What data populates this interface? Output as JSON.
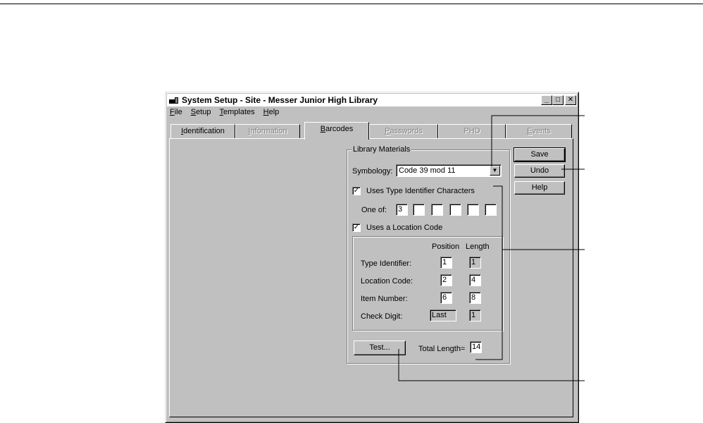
{
  "window": {
    "title": "System Setup - Site - Messer Junior High Library",
    "controls": {
      "minimize": "_",
      "maximize": "□",
      "close": "✕"
    }
  },
  "menu": [
    "File",
    "Setup",
    "Templates",
    "Help"
  ],
  "tabs": [
    {
      "label": "Identification",
      "state": "enabled"
    },
    {
      "label": "Information",
      "state": "disabled"
    },
    {
      "label": "Barcodes",
      "state": "active"
    },
    {
      "label": "Passwords",
      "state": "disabled"
    },
    {
      "label": "PHD",
      "state": "disabled"
    },
    {
      "label": "Events",
      "state": "disabled"
    }
  ],
  "group": {
    "title": "Library Materials",
    "symbology_label": "Symbology:",
    "symbology_value": "Code 39 mod 11",
    "uses_type_identifier": {
      "label": "Uses Type Identifier Characters",
      "checked": true
    },
    "one_of_label": "One of:",
    "one_of_values": [
      "3",
      "",
      "",
      "",
      "",
      ""
    ],
    "uses_location_code": {
      "label": "Uses a Location Code",
      "checked": true
    },
    "table_headers": {
      "position": "Position",
      "length": "Length"
    },
    "rows": [
      {
        "label": "Type Identifier:",
        "position": "1",
        "length": "1"
      },
      {
        "label": "Location Code:",
        "position": "2",
        "length": "4"
      },
      {
        "label": "Item Number:",
        "position": "6",
        "length": "8"
      },
      {
        "label": "Check Digit:",
        "position": "Last",
        "length": "1"
      }
    ],
    "test_button": "Test...",
    "total_length_label": "Total Length=",
    "total_length_value": "14"
  },
  "buttons": {
    "save": "Save",
    "undo": "Undo",
    "help": "Help"
  },
  "colors": {
    "face": "#c0c0c0",
    "shadow": "#808080",
    "highlight": "#ffffff"
  }
}
